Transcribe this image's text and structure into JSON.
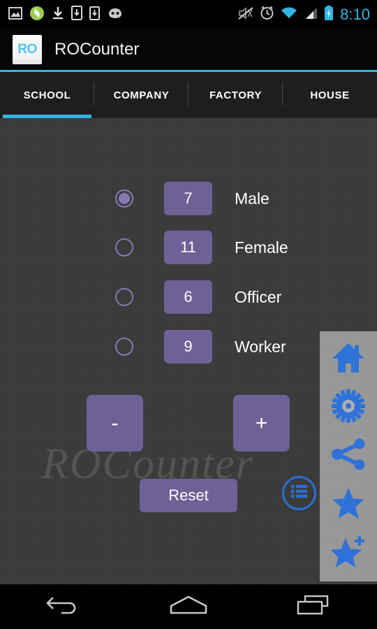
{
  "status_bar": {
    "icons": [
      {
        "name": "screenshot-icon"
      },
      {
        "name": "app-update-icon"
      },
      {
        "name": "download-icon"
      },
      {
        "name": "download-to-device-icon"
      },
      {
        "name": "sdcard-download-icon"
      },
      {
        "name": "android-head-icon"
      }
    ],
    "right_icons": [
      {
        "name": "mute-icon"
      },
      {
        "name": "alarm-icon"
      },
      {
        "name": "wifi-icon"
      },
      {
        "name": "cell-signal-icon"
      },
      {
        "name": "battery-charging-icon"
      }
    ],
    "clock": "8:10",
    "clock_color": "#33B5E5"
  },
  "action_bar": {
    "logo_text": "RO",
    "logo_text_color": "#4FC3F0",
    "title": "ROCounter",
    "accent_color": "#33B5E5"
  },
  "tabs": {
    "active_index": 0,
    "items": [
      {
        "label": "SCHOOL"
      },
      {
        "label": "COMPANY"
      },
      {
        "label": "FACTORY"
      },
      {
        "label": "HOUSE"
      }
    ]
  },
  "content": {
    "watermark": "ROCounter",
    "background_color": "#3B3B3B",
    "accent_purple": "#6E6196",
    "radio_color": "#8878B4",
    "counters": [
      {
        "label": "Male",
        "value": "7",
        "selected": true
      },
      {
        "label": "Female",
        "value": "11",
        "selected": false
      },
      {
        "label": "Officer",
        "value": "6",
        "selected": false
      },
      {
        "label": "Worker",
        "value": "9",
        "selected": false
      }
    ],
    "decrement_label": "-",
    "increment_label": "+",
    "reset_label": "Reset",
    "list_button_name": "list-icon",
    "list_button_color": "#2A6FD6"
  },
  "side_panel": {
    "icon_color": "#2F72D8",
    "background_color": "#AFAFAF",
    "items": [
      {
        "name": "home-icon",
        "label": "Home"
      },
      {
        "name": "gear-icon",
        "label": "Settings"
      },
      {
        "name": "share-icon",
        "label": "Share"
      },
      {
        "name": "star-icon",
        "label": "Favorite"
      },
      {
        "name": "star-plus-icon",
        "label": "Add to favorites"
      }
    ]
  },
  "nav_bar": {
    "items": [
      {
        "name": "back-icon",
        "label": "Back"
      },
      {
        "name": "home-icon",
        "label": "Home"
      },
      {
        "name": "recents-icon",
        "label": "Recent apps"
      }
    ]
  }
}
